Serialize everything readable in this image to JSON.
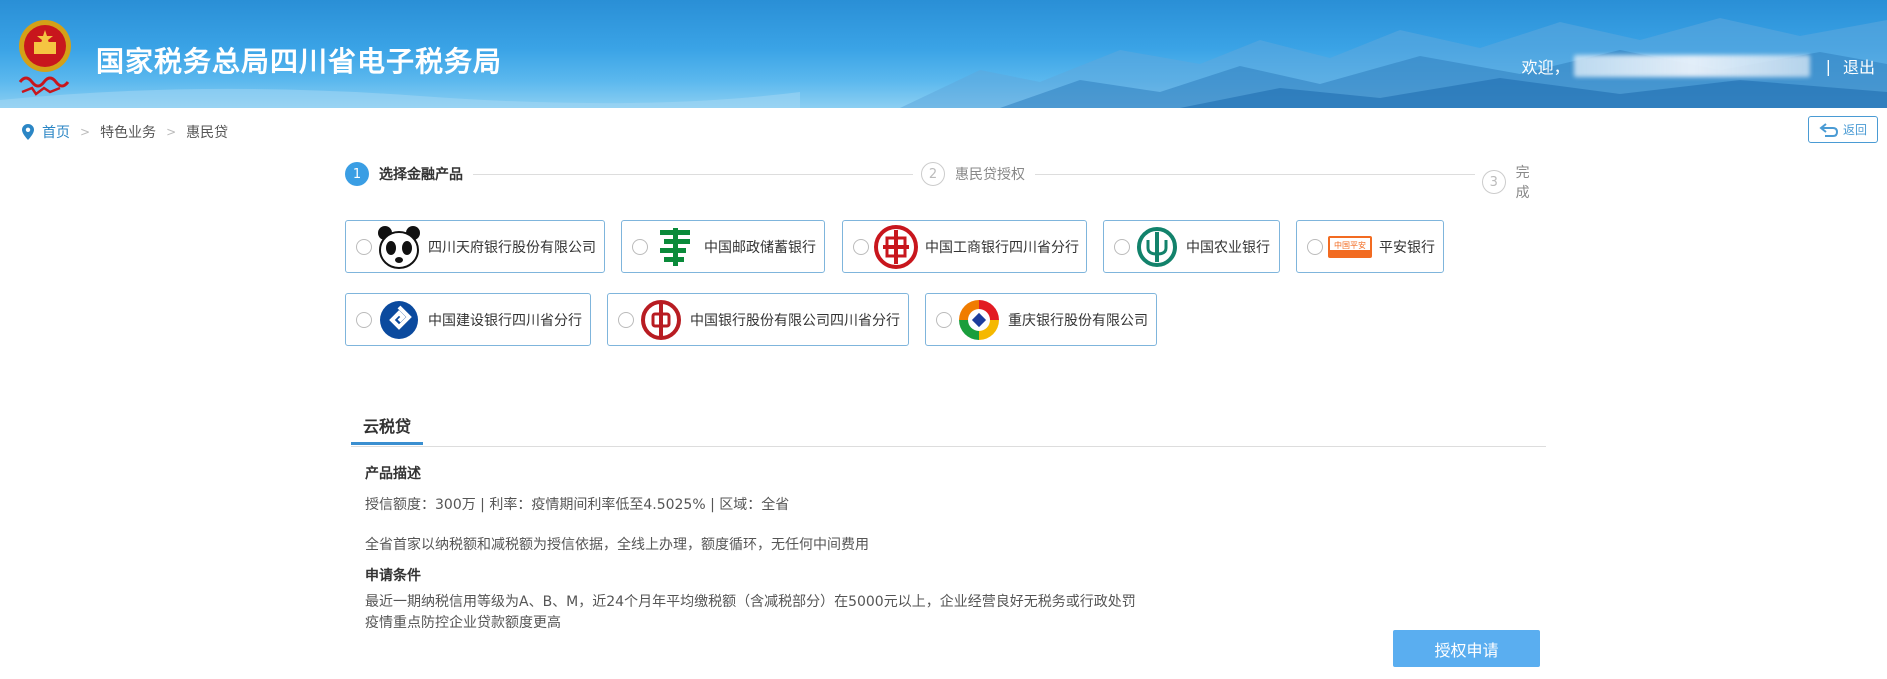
{
  "header": {
    "title": "国家税务总局四川省电子税务局",
    "welcome": "欢迎，",
    "separator": "|",
    "logout": "退出"
  },
  "breadcrumb": {
    "home": "首页",
    "level1": "特色业务",
    "level2": "惠民贷"
  },
  "back_button": "返回",
  "steps": [
    {
      "num": "1",
      "label": "选择金融产品"
    },
    {
      "num": "2",
      "label": "惠民贷授权"
    },
    {
      "num": "3",
      "label": "完成"
    }
  ],
  "banks": [
    {
      "name": "四川天府银行股份有限公司",
      "icon": "panda-logo-icon"
    },
    {
      "name": "中国邮政储蓄银行",
      "icon": "postal-bank-logo-icon"
    },
    {
      "name": "中国工商银行四川省分行",
      "icon": "icbc-logo-icon"
    },
    {
      "name": "中国农业银行",
      "icon": "abc-logo-icon"
    },
    {
      "name": "平安银行",
      "icon": "pingan-logo-icon",
      "logo_text": "中国平安"
    },
    {
      "name": "中国建设银行四川省分行",
      "icon": "ccb-logo-icon"
    },
    {
      "name": "中国银行股份有限公司四川省分行",
      "icon": "boc-logo-icon"
    },
    {
      "name": "重庆银行股份有限公司",
      "icon": "cq-bank-logo-icon"
    }
  ],
  "product": {
    "tab": "云税贷",
    "desc_title": "产品描述",
    "desc_line1": "授信额度：300万 | 利率：疫情期间利率低至4.5025% | 区域：全省",
    "desc_line2": "全省首家以纳税额和减税额为授信依据，全线上办理，额度循环，无任何中间费用",
    "cond_title": "申请条件",
    "cond_line1": "最近一期纳税信用等级为A、B、M，近24个月年平均缴税额（含减税部分）在5000元以上，企业经营良好无税务或行政处罚",
    "cond_line2": "疫情重点防控企业贷款额度更高"
  },
  "apply_button": "授权申请",
  "colors": {
    "accent": "#3a9ee4",
    "card_border": "#7fb5dc",
    "apply_button": "#5aaef0"
  }
}
